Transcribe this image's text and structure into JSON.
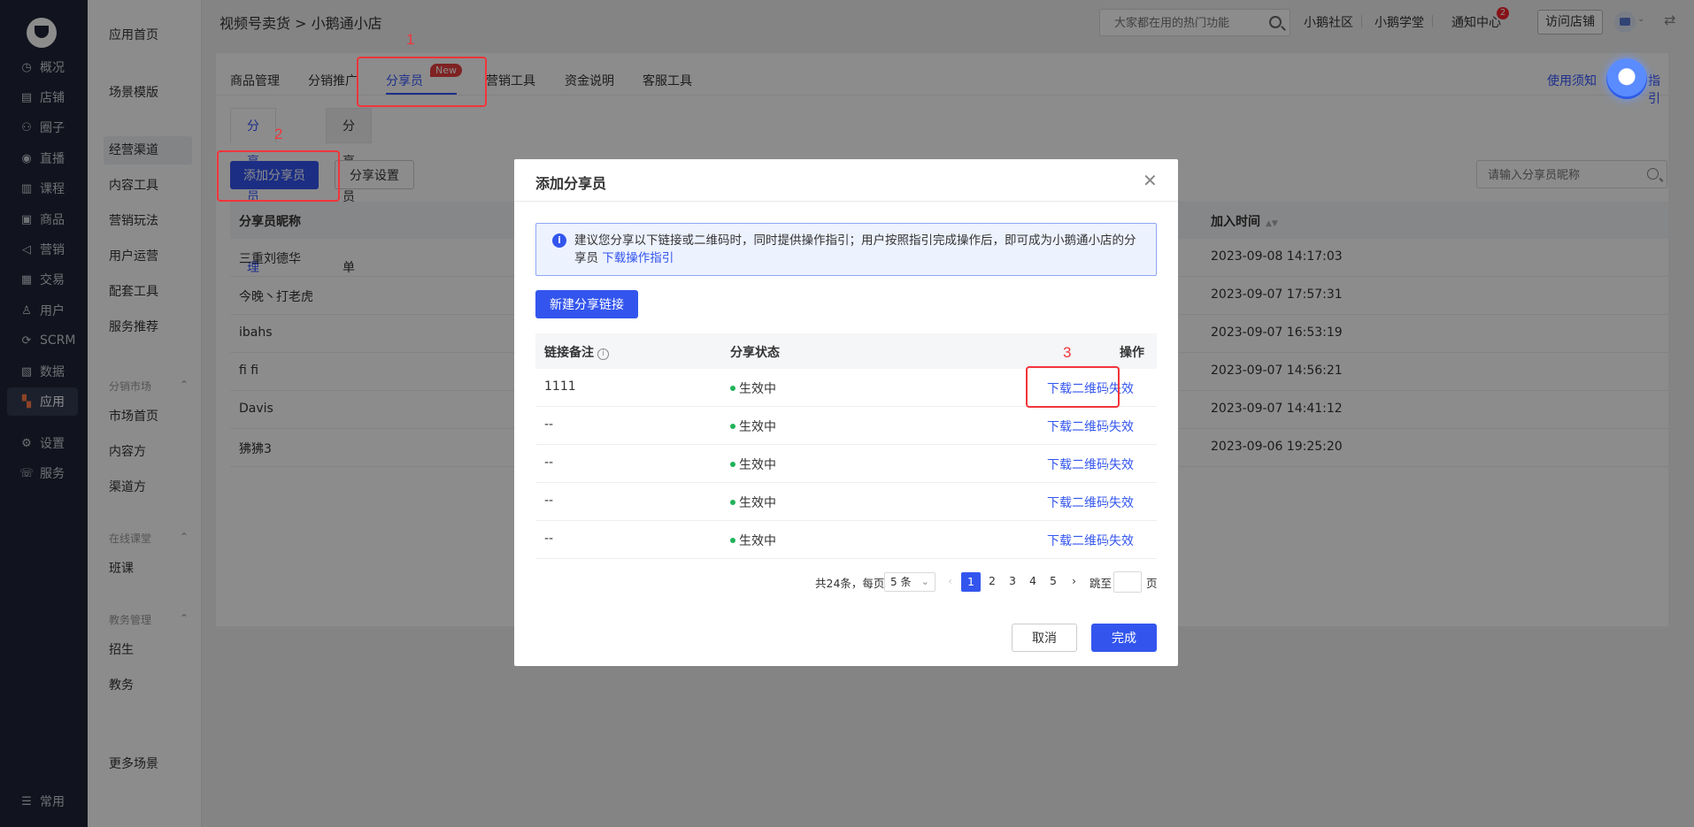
{
  "sidebar_main": {
    "items": [
      {
        "label": "概况",
        "icon": "dashboard-icon",
        "glyph": "◷"
      },
      {
        "label": "店铺",
        "icon": "store-icon",
        "glyph": "▤"
      },
      {
        "label": "圈子",
        "icon": "community-icon",
        "glyph": "⚇"
      },
      {
        "label": "直播",
        "icon": "live-icon",
        "glyph": "◉"
      },
      {
        "label": "课程",
        "icon": "course-icon",
        "glyph": "▥"
      },
      {
        "label": "商品",
        "icon": "goods-icon",
        "glyph": "▣"
      },
      {
        "label": "营销",
        "icon": "marketing-icon",
        "glyph": "◁"
      },
      {
        "label": "交易",
        "icon": "trade-icon",
        "glyph": "▦"
      },
      {
        "label": "用户",
        "icon": "user-icon",
        "glyph": "♙"
      },
      {
        "label": "SCRM",
        "icon": "scrm-icon",
        "glyph": "⟳"
      },
      {
        "label": "数据",
        "icon": "data-icon",
        "glyph": "▧"
      },
      {
        "label": "应用",
        "icon": "apps-icon",
        "glyph": "▚"
      },
      {
        "label": "设置",
        "icon": "settings-icon",
        "glyph": "⚙"
      },
      {
        "label": "服务",
        "icon": "service-icon",
        "glyph": "☏"
      }
    ],
    "bottom": {
      "label": "常用",
      "glyph": "☰"
    }
  },
  "sidebar_sub": {
    "items": [
      "应用首页",
      "场景模版",
      "经营渠道",
      "内容工具",
      "营销玩法",
      "用户运营",
      "配套工具",
      "服务推荐"
    ],
    "group1": {
      "title": "分销市场",
      "items": [
        "市场首页",
        "内容方",
        "渠道方"
      ]
    },
    "group2": {
      "title": "在线课堂",
      "items": [
        "班课"
      ]
    },
    "group3": {
      "title": "教务管理",
      "items": [
        "招生",
        "教务"
      ]
    },
    "more": "更多场景"
  },
  "header": {
    "breadcrumb": "视频号卖货 > 小鹅通小店",
    "search_placeholder": "大家都在用的热门功能",
    "links": [
      "小鹅社区",
      "小鹅学堂",
      "通知中心"
    ],
    "notify_count": "2",
    "visit_store": "访问店铺"
  },
  "tabs": {
    "items": [
      "商品管理",
      "分销推广",
      "分享员",
      "营销工具",
      "资金说明",
      "客服工具"
    ],
    "new_badge": "New",
    "right_link": "使用须知",
    "right_link2": "指引"
  },
  "sub_tabs": [
    "分享员管理",
    "分享员订单"
  ],
  "toolbar": {
    "add_sharer": "添加分享员",
    "share_settings": "分享设置",
    "search_placeholder": "请输入分享员昵称"
  },
  "sharers_table": {
    "headers": [
      "分享员昵称",
      "加入时间"
    ],
    "rows": [
      {
        "name": "三重刘德华",
        "time": "2023-09-08 14:17:03"
      },
      {
        "name": "今晚丶打老虎",
        "time": "2023-09-07 17:57:31"
      },
      {
        "name": "ibahs",
        "time": "2023-09-07 16:53:19"
      },
      {
        "name": "fi fi",
        "time": "2023-09-07 14:56:21"
      },
      {
        "name": "Davis",
        "time": "2023-09-07 14:41:12"
      },
      {
        "name": "狒狒3",
        "time": "2023-09-06 19:25:20"
      }
    ]
  },
  "modal": {
    "title": "添加分享员",
    "alert_text": "建议您分享以下链接或二维码时，同时提供操作指引；用户按照指引完成操作后，即可成为小鹅通小店的分享员",
    "alert_link": "下载操作指引",
    "new_link_button": "新建分享链接",
    "table_headers": [
      "链接备注",
      "分享状态",
      "操作"
    ],
    "rows": [
      {
        "remark": "1111",
        "status": "生效中",
        "op1": "下载二维码",
        "op2": "失效"
      },
      {
        "remark": "--",
        "status": "生效中",
        "op1": "下载二维码",
        "op2": "失效"
      },
      {
        "remark": "--",
        "status": "生效中",
        "op1": "下载二维码",
        "op2": "失效"
      },
      {
        "remark": "--",
        "status": "生效中",
        "op1": "下载二维码",
        "op2": "失效"
      },
      {
        "remark": "--",
        "status": "生效中",
        "op1": "下载二维码",
        "op2": "失效"
      }
    ],
    "pagination": {
      "total": "共24条，每页",
      "page_size": "5 条",
      "pages": [
        "1",
        "2",
        "3",
        "4",
        "5"
      ],
      "current": "1",
      "jump_label": "跳至",
      "page_unit": "页"
    },
    "cancel": "取消",
    "confirm": "完成"
  },
  "annotations": [
    "1",
    "2",
    "3"
  ],
  "colors": {
    "primary": "#3355ee",
    "sidebar_bg": "#202638",
    "annotation": "#f2353a",
    "status_green": "#21b25a"
  }
}
